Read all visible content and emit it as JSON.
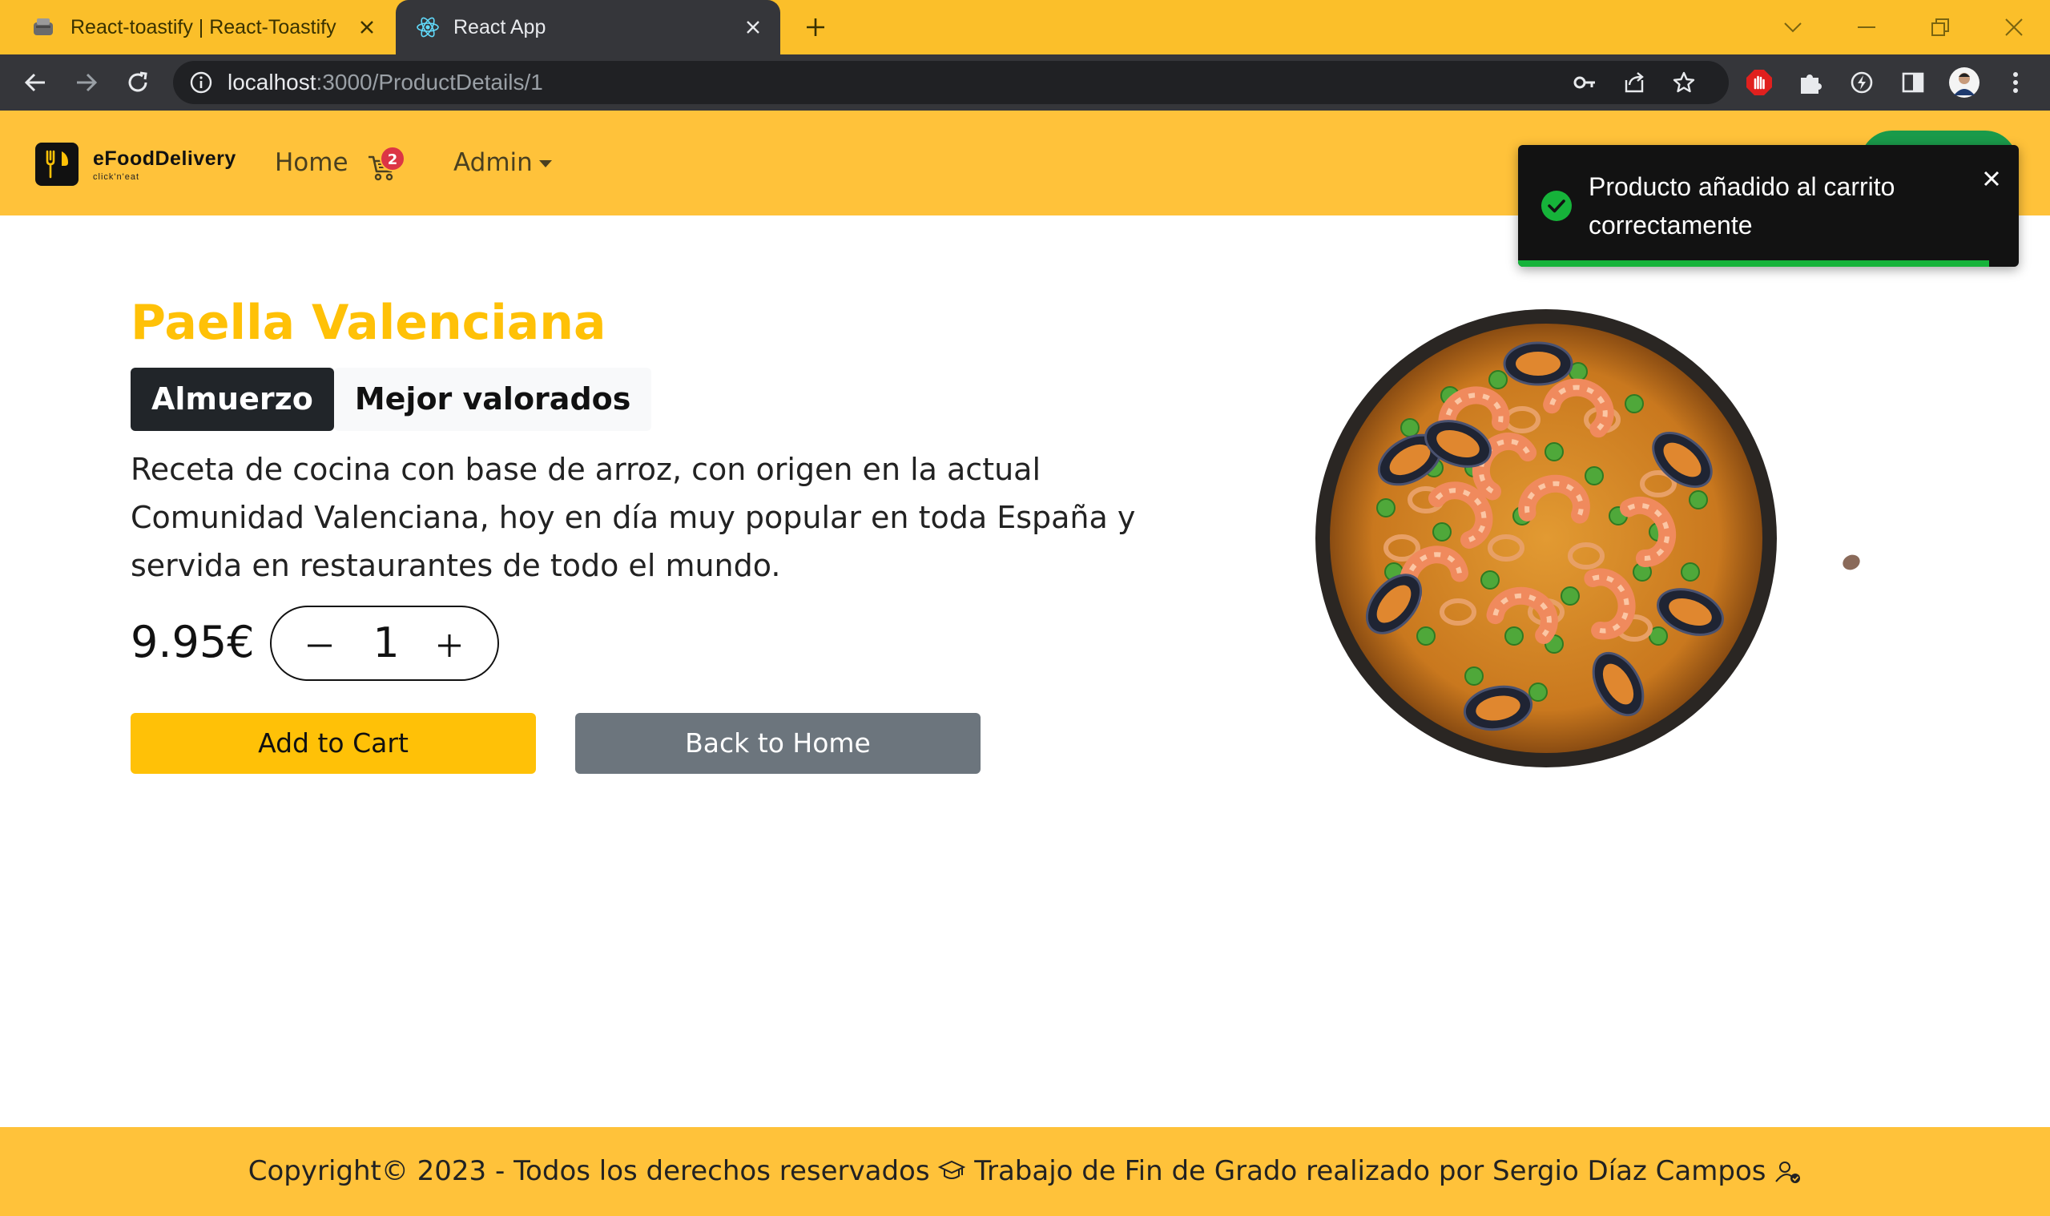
{
  "browser": {
    "tabs": [
      {
        "title": "React-toastify | React-Toastify",
        "icon": "toaster-icon",
        "active": false
      },
      {
        "title": "React App",
        "icon": "react-icon",
        "active": true
      }
    ],
    "url_host": "localhost",
    "url_path": ":3000/ProductDetails/1"
  },
  "navbar": {
    "brand_name": "eFoodDelivery",
    "brand_tagline": "click'n'eat",
    "home_label": "Home",
    "cart_count": "2",
    "admin_label": "Admin"
  },
  "toast": {
    "message": "Producto añadido al carrito correctamente",
    "type": "success",
    "progress": 0.94
  },
  "product": {
    "name": "Paella Valenciana",
    "tags": [
      "Almuerzo",
      "Mejor valorados"
    ],
    "description": "Receta de cocina con base de arroz, con origen en la actual Comunidad Valenciana, hoy en día muy popular en toda España y servida en restaurantes de todo el mundo.",
    "price": "9.95€",
    "quantity": "1",
    "add_to_cart_label": "Add to Cart",
    "back_label": "Back to Home"
  },
  "footer": {
    "copyright": "Copyright© 2023 - Todos los derechos reservados",
    "credit": "Trabajo de Fin de Grado realizado por Sergio Díaz Campos"
  },
  "colors": {
    "accent": "#ffc107",
    "navbar_bg": "#ffc23a",
    "toast_bg": "#121212",
    "toast_success": "#16b33a",
    "badge": "#dc3545",
    "secondary_button": "#6c757d"
  }
}
